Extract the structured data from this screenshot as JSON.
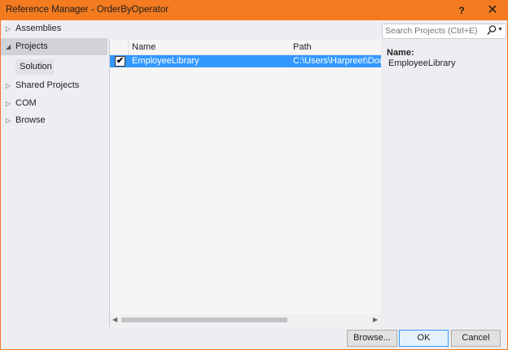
{
  "window": {
    "title": "Reference Manager - OrderByOperator",
    "help_label": "?",
    "close_label": "✕"
  },
  "nav": {
    "items": [
      {
        "label": "Assemblies",
        "expanded": false
      },
      {
        "label": "Projects",
        "expanded": true,
        "selected": true
      },
      {
        "label": "Shared Projects",
        "expanded": false
      },
      {
        "label": "COM",
        "expanded": false
      },
      {
        "label": "Browse",
        "expanded": false
      }
    ],
    "sub_item": "Solution",
    "collapsed_arrow": "▷",
    "expanded_arrow": "◢"
  },
  "list": {
    "columns": {
      "name": "Name",
      "path": "Path"
    },
    "rows": [
      {
        "checked": true,
        "check_glyph": "✔",
        "name": "EmployeeLibrary",
        "path": "C:\\Users\\Harpreet\\Docum"
      }
    ],
    "scroll_left": "◀",
    "scroll_right": "▶"
  },
  "search": {
    "placeholder": "Search Projects (Ctrl+E)",
    "value": "",
    "icon": "search-icon",
    "dropdown_icon": "▼"
  },
  "details": {
    "name_label": "Name:",
    "name_value": "EmployeeLibrary"
  },
  "footer": {
    "browse_label": "Browse...",
    "ok_label": "OK",
    "cancel_label": "Cancel"
  },
  "colors": {
    "title_bar": "#f47b20",
    "selection": "#3399ff",
    "pane_bg": "#eeeef2"
  }
}
